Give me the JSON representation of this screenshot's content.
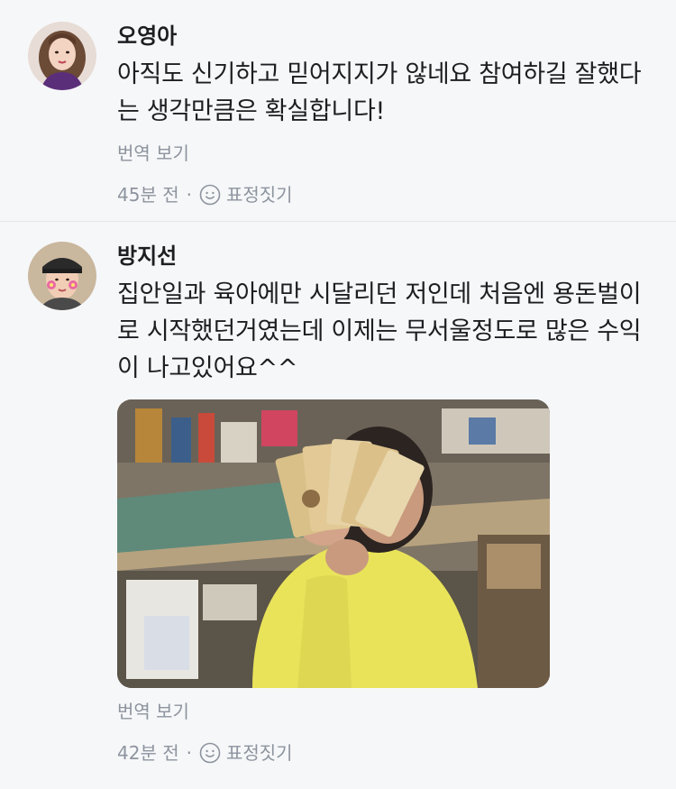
{
  "comments": [
    {
      "author": "오영아",
      "text": "아직도 신기하고 믿어지지가 않네요 참여하길 잘했다는 생각만큼은 확실합니다!",
      "translate_label": "번역 보기",
      "time": "45분 전",
      "separator": "·",
      "reaction_label": "표정짓기"
    },
    {
      "author": "방지선",
      "text": "집안일과 육아에만 시달리던 저인데 처음엔 용돈벌이로 시작했던거였는데 이제는 무서울정도로 많은 수익이 나고있어요^^",
      "translate_label": "번역 보기",
      "time": "42분 전",
      "separator": "·",
      "reaction_label": "표정짓기"
    }
  ]
}
